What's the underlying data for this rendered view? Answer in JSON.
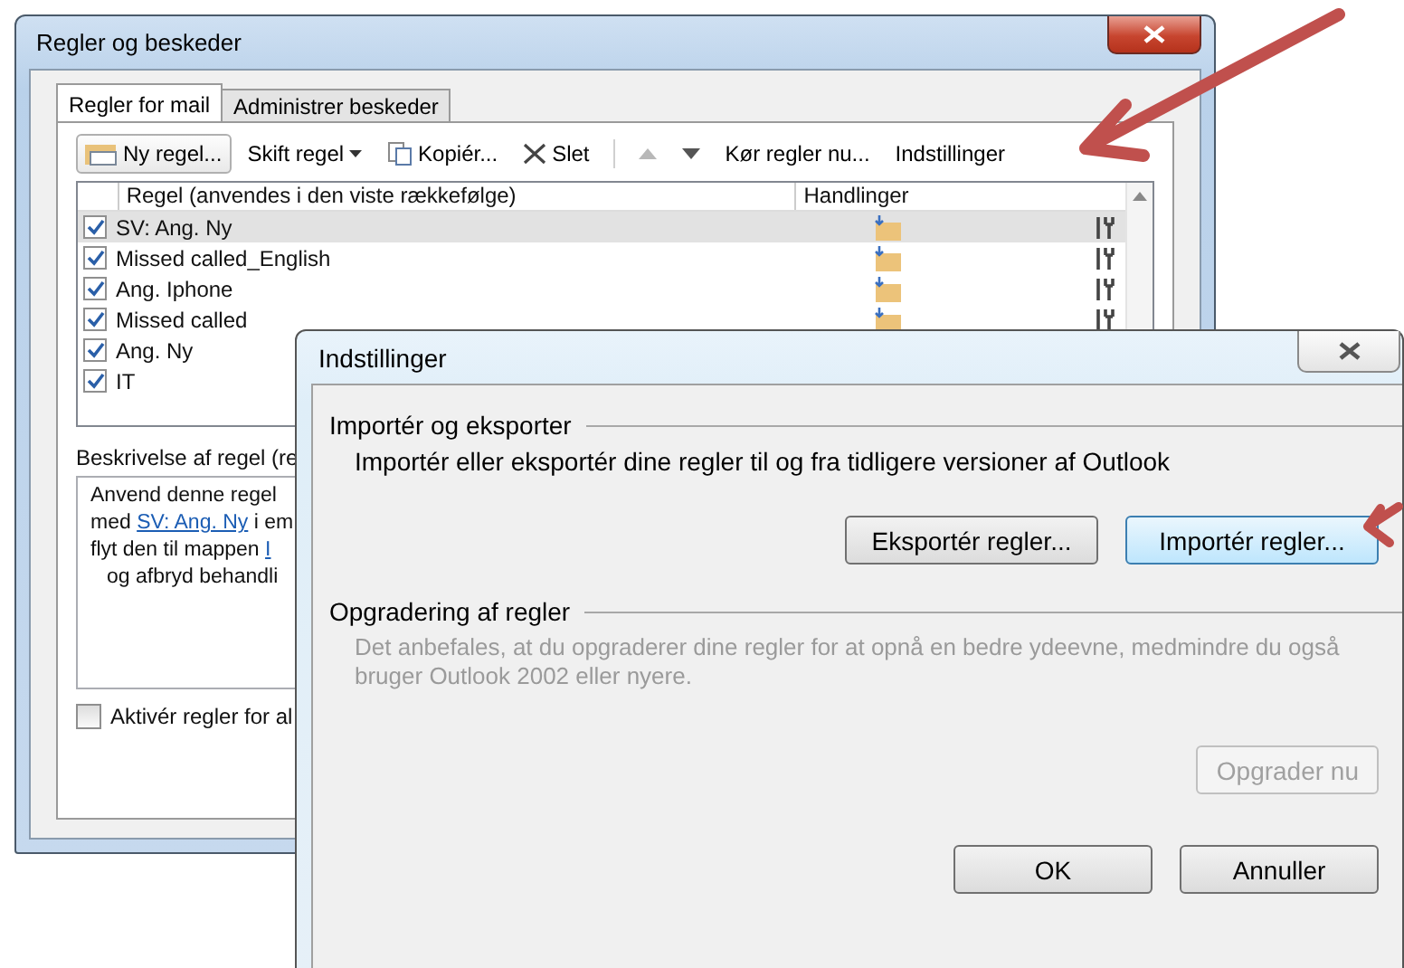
{
  "rules_window": {
    "title": "Regler og beskeder",
    "tabs": [
      {
        "label": "Regler for mail",
        "selected": true
      },
      {
        "label": "Administrer beskeder",
        "selected": false
      }
    ],
    "toolbar": [
      {
        "kind": "new",
        "label": "Ny regel..."
      },
      {
        "kind": "dropdown",
        "label": "Skift regel"
      },
      {
        "kind": "copy",
        "label": "Kopiér..."
      },
      {
        "kind": "delete",
        "label": "Slet"
      },
      {
        "kind": "separator"
      },
      {
        "kind": "up",
        "disabled": true
      },
      {
        "kind": "down",
        "disabled": false
      },
      {
        "kind": "text",
        "label": "Kør regler nu..."
      },
      {
        "kind": "text",
        "label": "Indstillinger"
      }
    ],
    "columns": [
      "Regel (anvendes i den viste rækkefølge)",
      "Handlinger"
    ],
    "rows": [
      {
        "name": "SV: Ang. Ny",
        "checked": true,
        "selected": true,
        "icons_shown": true
      },
      {
        "name": "Missed called_English",
        "checked": true,
        "selected": false,
        "icons_shown": true
      },
      {
        "name": "Ang. Iphone",
        "checked": true,
        "selected": false,
        "icons_shown": true
      },
      {
        "name": "Missed called",
        "checked": true,
        "selected": false,
        "icons_shown": true
      },
      {
        "name": "Ang. Ny",
        "checked": true,
        "selected": false,
        "icons_shown": false
      },
      {
        "name": "IT",
        "checked": true,
        "selected": false,
        "icons_shown": false
      }
    ],
    "description_label": "Beskrivelse af regel (re",
    "description_lines": [
      [
        {
          "text": "Anvend denne regel",
          "link": false
        }
      ],
      [
        {
          "text": "med ",
          "link": false
        },
        {
          "text": "SV: Ang. Ny",
          "link": true
        },
        {
          "text": " i em",
          "link": false
        }
      ],
      [
        {
          "text": "flyt den til mappen ",
          "link": false
        },
        {
          "text": "I",
          "link": true
        }
      ],
      [
        {
          "text": "og afbryd behandli",
          "link": false
        }
      ]
    ],
    "enable_all": {
      "label": "Aktivér regler for al",
      "checked": false
    }
  },
  "settings_dialog": {
    "title": "Indstillinger",
    "groups": [
      {
        "title": "Importér og eksporter",
        "text": "Importér eller eksportér dine regler til og fra tidligere versioner af Outlook",
        "disabled": false,
        "buttons": [
          {
            "label": "Eksportér regler...",
            "highlighted": false,
            "disabled": false
          },
          {
            "label": "Importér regler...",
            "highlighted": true,
            "disabled": false
          }
        ]
      },
      {
        "title": "Opgradering af regler",
        "text": "Det anbefales, at du opgraderer dine regler for at opnå en bedre ydeevne, medmindre du også bruger Outlook 2002 eller nyere.",
        "disabled": true,
        "buttons": [
          {
            "label": "Opgrader nu",
            "highlighted": false,
            "disabled": true
          }
        ]
      }
    ],
    "buttons": [
      "OK",
      "Annuller"
    ]
  }
}
